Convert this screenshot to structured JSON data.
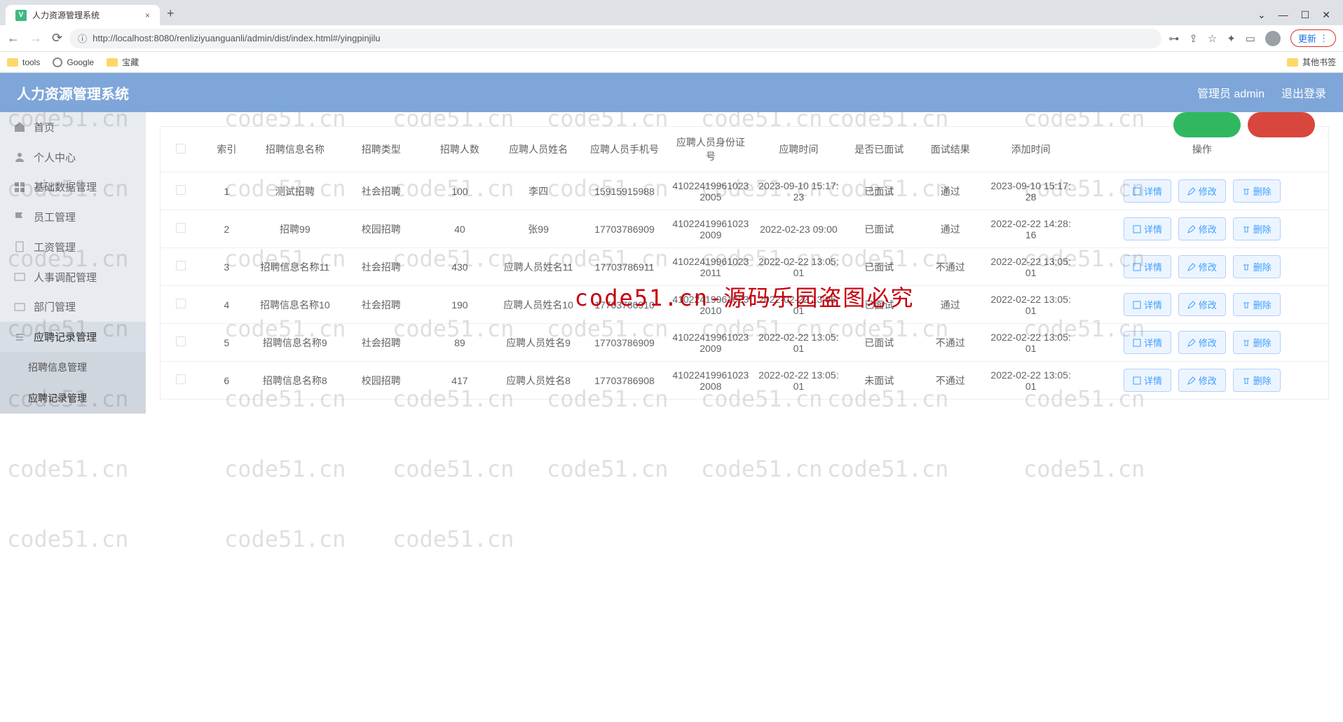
{
  "browser": {
    "tab_title": "人力资源管理系统",
    "url": "http://localhost:8080/renliziyuanguanli/admin/dist/index.html#/yingpinjilu",
    "update_btn": "更新",
    "bookmarks": {
      "tools": "tools",
      "google": "Google",
      "treasure": "宝藏",
      "other": "其他书签"
    }
  },
  "header": {
    "title": "人力资源管理系统",
    "user_label": "管理员 admin",
    "logout": "退出登录"
  },
  "sidebar": {
    "items": [
      {
        "label": "首页"
      },
      {
        "label": "个人中心"
      },
      {
        "label": "基础数据管理"
      },
      {
        "label": "员工管理"
      },
      {
        "label": "工资管理"
      },
      {
        "label": "人事调配管理"
      },
      {
        "label": "部门管理"
      },
      {
        "label": "应聘记录管理"
      }
    ],
    "sub": {
      "info": "招聘信息管理",
      "record": "应聘记录管理"
    }
  },
  "table": {
    "headers": {
      "index": "索引",
      "job_name": "招聘信息名称",
      "job_type": "招聘类型",
      "headcount": "招聘人数",
      "applicant_name": "应聘人员姓名",
      "applicant_phone": "应聘人员手机号",
      "applicant_id": "应聘人员身份证号",
      "apply_time": "应聘时间",
      "interviewed": "是否已面试",
      "result": "面试结果",
      "add_time": "添加时间",
      "ops": "操作"
    },
    "ops_labels": {
      "detail": "详情",
      "edit": "修改",
      "delete": "删除"
    },
    "rows": [
      {
        "idx": "1",
        "job_name": "测试招聘",
        "job_type": "社会招聘",
        "headcount": "100",
        "applicant_name": "李四",
        "phone": "15915915988",
        "id_no": "41022419961023 2005",
        "apply_time": "2023-09-10 15:17:23",
        "interviewed": "已面试",
        "result": "通过",
        "add_time": "2023-09-10 15:17:28"
      },
      {
        "idx": "2",
        "job_name": "招聘99",
        "job_type": "校园招聘",
        "headcount": "40",
        "applicant_name": "张99",
        "phone": "17703786909",
        "id_no": "41022419961023 2009",
        "apply_time": "2022-02-23 09:00",
        "interviewed": "已面试",
        "result": "通过",
        "add_time": "2022-02-22 14:28:16"
      },
      {
        "idx": "3",
        "job_name": "招聘信息名称11",
        "job_type": "社会招聘",
        "headcount": "430",
        "applicant_name": "应聘人员姓名11",
        "phone": "17703786911",
        "id_no": "41022419961023 2011",
        "apply_time": "2022-02-22 13:05:01",
        "interviewed": "已面试",
        "result": "不通过",
        "add_time": "2022-02-22 13:05:01"
      },
      {
        "idx": "4",
        "job_name": "招聘信息名称10",
        "job_type": "社会招聘",
        "headcount": "190",
        "applicant_name": "应聘人员姓名10",
        "phone": "17703786910",
        "id_no": "41022419961023 2010",
        "apply_time": "2022-02-22 13:05:01",
        "interviewed": "已面试",
        "result": "通过",
        "add_time": "2022-02-22 13:05:01"
      },
      {
        "idx": "5",
        "job_name": "招聘信息名称9",
        "job_type": "社会招聘",
        "headcount": "89",
        "applicant_name": "应聘人员姓名9",
        "phone": "17703786909",
        "id_no": "41022419961023 2009",
        "apply_time": "2022-02-22 13:05:01",
        "interviewed": "已面试",
        "result": "不通过",
        "add_time": "2022-02-22 13:05:01"
      },
      {
        "idx": "6",
        "job_name": "招聘信息名称8",
        "job_type": "校园招聘",
        "headcount": "417",
        "applicant_name": "应聘人员姓名8",
        "phone": "17703786908",
        "id_no": "41022419961023 2008",
        "apply_time": "2022-02-22 13:05:01",
        "interviewed": "未面试",
        "result": "不通过",
        "add_time": "2022-02-22 13:05:01"
      }
    ]
  },
  "watermark": "code51.cn",
  "watermark_red": "code51.cn-源码乐园盗图必究"
}
